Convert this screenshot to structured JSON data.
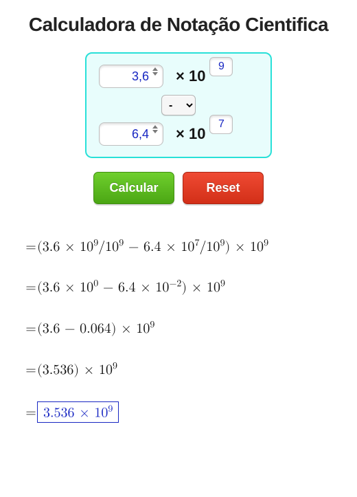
{
  "title": "Calculadora de Notação Cientifica",
  "inputs": {
    "coef1": "3,6",
    "exp1": "9",
    "operator": "-",
    "coef2": "6,4",
    "exp2": "7",
    "times10_label": "× 10"
  },
  "buttons": {
    "calcular": "Calcular",
    "reset": "Reset"
  },
  "steps": {
    "s1": {
      "prefix": "= ",
      "body": "(3.6 × 10⁹/10⁹ − 6.4 × 10⁷/10⁹) × 10⁹"
    },
    "s2": {
      "prefix": "= ",
      "body": "(3.6 × 10⁰ − 6.4 × 10⁻²) × 10⁹"
    },
    "s3": {
      "prefix": "= ",
      "body": "(3.6 − 0.064) × 10⁹"
    },
    "s4": {
      "prefix": "= ",
      "body": "(3.536) × 10⁹"
    },
    "s5": {
      "prefix": "= ",
      "final": "3.536 × 10⁹"
    }
  }
}
